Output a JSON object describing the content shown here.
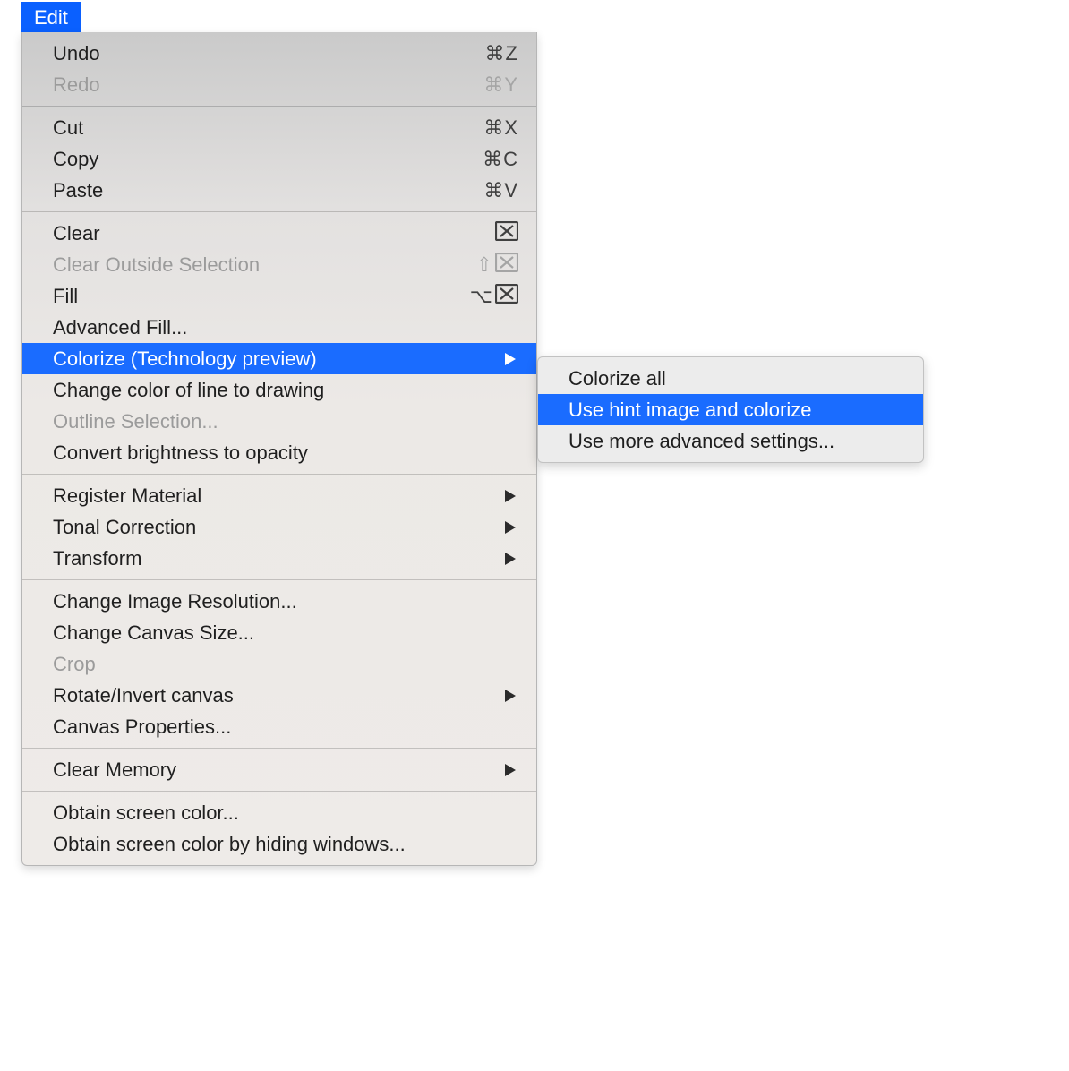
{
  "menuTitle": "Edit",
  "mainMenu": {
    "groups": [
      [
        {
          "id": "undo",
          "label": "Undo",
          "shortcut": "⌘Z",
          "disabled": false
        },
        {
          "id": "redo",
          "label": "Redo",
          "shortcut": "⌘Y",
          "disabled": true
        }
      ],
      [
        {
          "id": "cut",
          "label": "Cut",
          "shortcut": "⌘X",
          "disabled": false
        },
        {
          "id": "copy",
          "label": "Copy",
          "shortcut": "⌘C",
          "disabled": false
        },
        {
          "id": "paste",
          "label": "Paste",
          "shortcut": "⌘V",
          "disabled": false
        }
      ],
      [
        {
          "id": "clear",
          "label": "Clear",
          "shortcutIcon": "delbox",
          "shortcutPrefix": "",
          "disabled": false
        },
        {
          "id": "clear-outside-selection",
          "label": "Clear Outside Selection",
          "shortcutIcon": "delbox",
          "shortcutPrefix": "⇧",
          "disabled": true
        },
        {
          "id": "fill",
          "label": "Fill",
          "shortcutIcon": "delbox",
          "shortcutPrefix": "⌥",
          "disabled": false
        },
        {
          "id": "advanced-fill",
          "label": "Advanced Fill...",
          "disabled": false
        },
        {
          "id": "colorize",
          "label": "Colorize (Technology preview)",
          "submenu": true,
          "highlighted": true,
          "disabled": false
        },
        {
          "id": "change-color-line",
          "label": "Change color of line to drawing",
          "disabled": false
        },
        {
          "id": "outline-selection",
          "label": "Outline Selection...",
          "disabled": true
        },
        {
          "id": "convert-brightness",
          "label": "Convert brightness to opacity",
          "disabled": false
        }
      ],
      [
        {
          "id": "register-material",
          "label": "Register Material",
          "submenu": true,
          "disabled": false
        },
        {
          "id": "tonal-correction",
          "label": "Tonal Correction",
          "submenu": true,
          "disabled": false
        },
        {
          "id": "transform",
          "label": "Transform",
          "submenu": true,
          "disabled": false
        }
      ],
      [
        {
          "id": "change-image-resolution",
          "label": "Change Image Resolution...",
          "disabled": false
        },
        {
          "id": "change-canvas-size",
          "label": "Change Canvas Size...",
          "disabled": false
        },
        {
          "id": "crop",
          "label": "Crop",
          "disabled": true
        },
        {
          "id": "rotate-invert-canvas",
          "label": "Rotate/Invert canvas",
          "submenu": true,
          "disabled": false
        },
        {
          "id": "canvas-properties",
          "label": "Canvas Properties...",
          "disabled": false
        }
      ],
      [
        {
          "id": "clear-memory",
          "label": "Clear Memory",
          "submenu": true,
          "disabled": false
        }
      ],
      [
        {
          "id": "obtain-screen-color",
          "label": "Obtain screen color...",
          "disabled": false
        },
        {
          "id": "obtain-screen-color-hiding",
          "label": "Obtain screen color by hiding windows...",
          "disabled": false
        }
      ]
    ]
  },
  "submenu": {
    "items": [
      {
        "id": "colorize-all",
        "label": "Colorize all",
        "highlighted": false
      },
      {
        "id": "use-hint-image",
        "label": "Use hint image and colorize",
        "highlighted": true
      },
      {
        "id": "use-advanced-settings",
        "label": "Use more advanced settings...",
        "highlighted": false
      }
    ]
  }
}
